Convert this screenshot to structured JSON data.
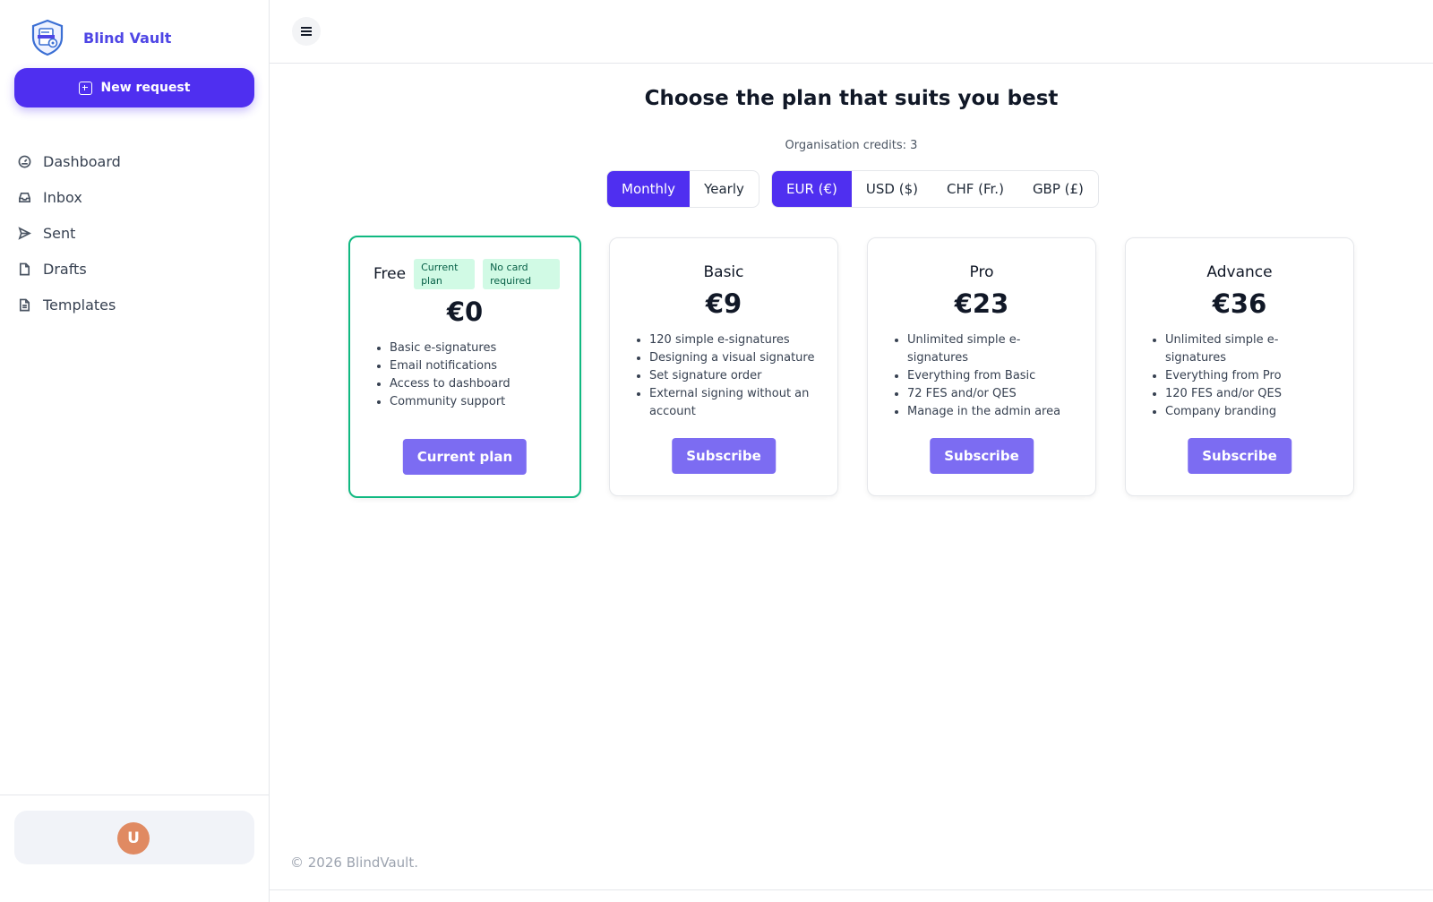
{
  "brand": {
    "name": "Blind Vault"
  },
  "sidebar": {
    "new_request": "New request",
    "items": [
      {
        "label": "Dashboard",
        "icon": "dashboard-icon"
      },
      {
        "label": "Inbox",
        "icon": "inbox-icon"
      },
      {
        "label": "Sent",
        "icon": "send-icon"
      },
      {
        "label": "Drafts",
        "icon": "file-icon"
      },
      {
        "label": "Templates",
        "icon": "file-text-icon"
      }
    ],
    "user_initial": "U"
  },
  "main": {
    "title": "Choose the plan that suits you best",
    "credits": "Organisation credits: 3",
    "period_options": [
      "Monthly",
      "Yearly"
    ],
    "period_selected": "Monthly",
    "currency_options": [
      "EUR (€)",
      "USD ($)",
      "CHF (Fr.)",
      "GBP (£)"
    ],
    "currency_selected": "EUR (€)",
    "plans": [
      {
        "name": "Free",
        "badges": [
          "Current plan",
          "No card required"
        ],
        "price": "€0",
        "features": [
          "Basic e-signatures",
          "Email notifications",
          "Access to dashboard",
          "Community support"
        ],
        "button": "Current plan"
      },
      {
        "name": "Basic",
        "price": "€9",
        "features": [
          "120 simple e-signatures",
          "Designing a visual signature",
          "Set signature order",
          "External signing without an account"
        ],
        "button": "Subscribe"
      },
      {
        "name": "Pro",
        "price": "€23",
        "features": [
          "Unlimited simple e-signatures",
          "Everything from Basic",
          "72 FES and/or QES",
          "Manage in the admin area"
        ],
        "button": "Subscribe"
      },
      {
        "name": "Advance",
        "price": "€36",
        "features": [
          "Unlimited simple e-signatures",
          "Everything from Pro",
          "120 FES and/or QES",
          "Company branding"
        ],
        "button": "Subscribe"
      }
    ]
  },
  "footer": {
    "copyright": "© 2026 BlindVault."
  },
  "colors": {
    "accent": "#4f2ff0",
    "button": "#7c6cf2",
    "current_border": "#10b981",
    "badge_bg": "#d1fae5"
  }
}
